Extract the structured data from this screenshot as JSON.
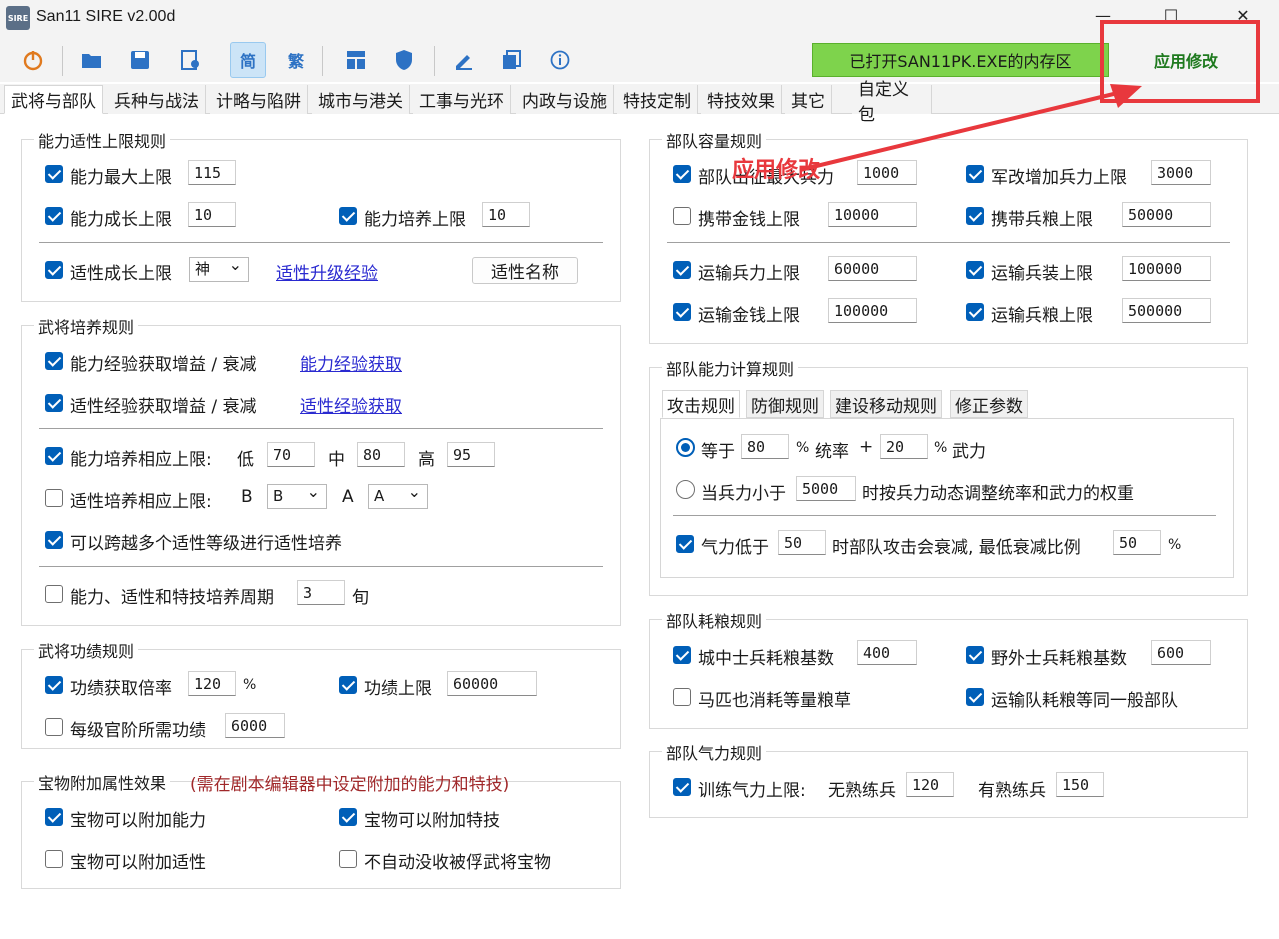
{
  "window": {
    "title": "San11 SIRE v2.00d",
    "icon_text": "SIRE",
    "min": "—",
    "max": "☐",
    "close": "✕"
  },
  "toolbar": {
    "icons": [
      "power-icon",
      "open-folder-icon",
      "save-icon",
      "settings-file-icon",
      "simplified-chinese-icon",
      "traditional-chinese-icon",
      "grid-icon",
      "shield-icon",
      "edit-icon",
      "copy-icon",
      "info-icon"
    ],
    "simplified_label": "简",
    "traditional_label": "繁",
    "status_text": "已打开SAN11PK.EXE的内存区",
    "apply_label": "应用修改",
    "accent": "#7ed34c"
  },
  "annotation": {
    "text": "应用修改",
    "color": "#e8383d"
  },
  "tabs": [
    "武将与部队",
    "兵种与战法",
    "计略与陷阱",
    "城市与港关",
    "工事与光环",
    "内政与设施",
    "特技定制",
    "特技效果",
    "其它",
    "自定义包"
  ],
  "left": {
    "ability": {
      "title": "能力适性上限规则",
      "max_label": "能力最大上限",
      "max_value": "115",
      "growth_label": "能力成长上限",
      "growth_value": "10",
      "train_label": "能力培养上限",
      "train_value": "10",
      "apt_label": "适性成长上限",
      "apt_value": "神",
      "apt_link": "适性升级经验",
      "apt_name_button": "适性名称"
    },
    "training": {
      "title": "武将培养规则",
      "exp_label": "能力经验获取增益 / 衰减",
      "exp_link": "能力经验获取",
      "apt_exp_label": "适性经验获取增益 / 衰减",
      "apt_exp_link": "适性经验获取",
      "train_limit_label": "能力培养相应上限:",
      "low_label": "低",
      "low_value": "70",
      "mid_label": "中",
      "mid_value": "80",
      "high_label": "高",
      "high_value": "95",
      "apt_train_label": "适性培养相应上限:",
      "b_label": "B",
      "b_value": "B",
      "a_label": "A",
      "a_value": "A",
      "cross_label": "可以跨越多个适性等级进行适性培养",
      "period_label": "能力、适性和特技培养周期",
      "period_value": "3",
      "period_unit": "旬"
    },
    "merit": {
      "title": "武将功绩规则",
      "rate_label": "功绩获取倍率",
      "rate_value": "120",
      "rate_unit": "%",
      "cap_label": "功绩上限",
      "cap_value": "60000",
      "rank_label": "每级官阶所需功绩",
      "rank_value": "6000"
    },
    "treasure": {
      "title": "宝物附加属性效果",
      "note": "(需在剧本编辑器中设定附加的能力和特技)",
      "ability_label": "宝物可以附加能力",
      "skill_label": "宝物可以附加特技",
      "apt_label": "宝物可以附加适性",
      "noconfiscate_label": "不自动没收被俘武将宝物"
    }
  },
  "right": {
    "capacity": {
      "title": "部队容量规则",
      "troops_label": "部队出征最大兵力",
      "troops_value": "1000",
      "reform_label": "军改增加兵力上限",
      "reform_value": "3000",
      "gold_label": "携带金钱上限",
      "gold_value": "10000",
      "food_label": "携带兵粮上限",
      "food_value": "50000",
      "trans_troops_label": "运输兵力上限",
      "trans_troops_value": "60000",
      "trans_equip_label": "运输兵装上限",
      "trans_equip_value": "100000",
      "trans_gold_label": "运输金钱上限",
      "trans_gold_value": "100000",
      "trans_food_label": "运输兵粮上限",
      "trans_food_value": "500000"
    },
    "calc": {
      "title": "部队能力计算规则",
      "subtabs": [
        "攻击规则",
        "防御规则",
        "建设移动规则",
        "修正参数"
      ],
      "eq_label": "等于",
      "eq_value1": "80",
      "pct": "%",
      "lead_label": "统率",
      "plus": "+",
      "eq_value2": "20",
      "war_label": "武力",
      "when_label": "当兵力小于",
      "when_value": "5000",
      "when_tail": "时按兵力动态调整统率和武力的权重",
      "morale_label": "气力低于",
      "morale_value": "50",
      "morale_mid": "时部队攻击会衰减, 最低衰减比例",
      "morale_min_value": "50"
    },
    "food": {
      "title": "部队耗粮规则",
      "city_label": "城中士兵耗粮基数",
      "city_value": "400",
      "field_label": "野外士兵耗粮基数",
      "field_value": "600",
      "horse_label": "马匹也消耗等量粮草",
      "transport_label": "运输队耗粮等同一般部队"
    },
    "morale": {
      "title": "部队气力规则",
      "train_label": "训练气力上限:",
      "untrained_label": "无熟练兵",
      "untrained_value": "120",
      "trained_label": "有熟练兵",
      "trained_value": "150"
    }
  }
}
